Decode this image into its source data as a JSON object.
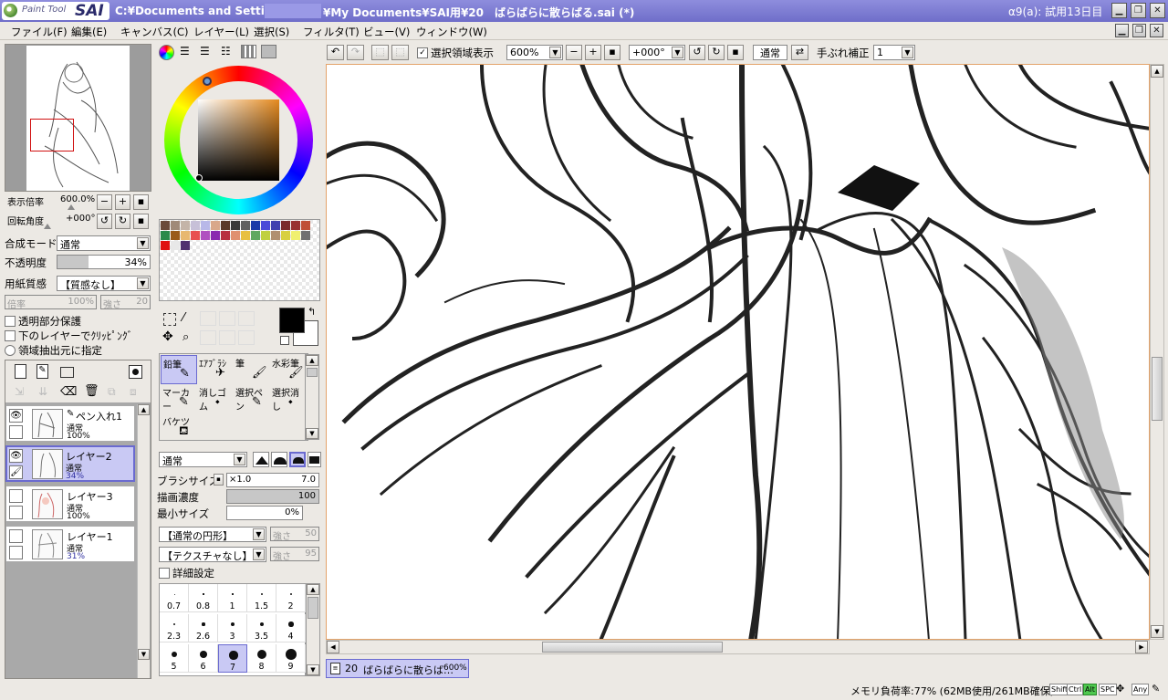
{
  "title": {
    "logo_small": "Paint Tool",
    "logo_big": "SAI",
    "path_start": "C:¥Documents and Settings",
    "path_end": "¥My Documents¥SAI用¥20　ばらばらに散らばる.sai (*)",
    "version": "α9(a): 試用13日目"
  },
  "menu": [
    "ファイル(F)",
    "編集(E)",
    "キャンバス(C)",
    "レイヤー(L)",
    "選択(S)",
    "フィルタ(T)",
    "ビュー(V)",
    "ウィンドウ(W)"
  ],
  "navigator": {
    "zoom_label": "表示倍率",
    "zoom_value": "600.0%",
    "rotate_label": "回転角度",
    "rotate_value": "+000°"
  },
  "layer_props": {
    "blend_label": "合成モード",
    "blend_value": "通常",
    "opacity_label": "不透明度",
    "opacity_value": "34%",
    "opacity_fraction": 0.34,
    "paper_label": "用紙質感",
    "paper_value": "【質感なし】",
    "scale_label": "倍率",
    "scale_value": "100%",
    "strength_label": "強さ",
    "strength_value": "20",
    "protect": "透明部分保護",
    "clip": "下のレイヤーでｸﾘｯﾋﾟﾝｸﾞ",
    "selsrc": "領域抽出元に指定"
  },
  "layers": [
    {
      "name": "ペン入れ1",
      "mode": "通常",
      "opacity": "100%",
      "visible": true,
      "selected": false
    },
    {
      "name": "レイヤー2",
      "mode": "通常",
      "opacity": "34%",
      "visible": true,
      "selected": true
    },
    {
      "name": "レイヤー3",
      "mode": "通常",
      "opacity": "100%",
      "visible": false,
      "selected": false
    },
    {
      "name": "レイヤー1",
      "mode": "通常",
      "opacity": "31%",
      "visible": false,
      "selected": false
    }
  ],
  "swatch_colors": [
    "#6b4a3a",
    "#a08a78",
    "#c4b4a8",
    "#c7c0d8",
    "#b8b8e8",
    "#d9a88a",
    "#5a3a2a",
    "#3b3b3b",
    "#606060",
    "#1a3aa8",
    "#4a4ad8",
    "#4040b0",
    "#7a2a2a",
    "#983030",
    "#c05038",
    "#2a8a4a",
    "#9a5a1a",
    "#e8b870",
    "#e85050",
    "#b050c0",
    "#8a2ab0",
    "#b83040",
    "#e09070",
    "#e8c040",
    "#60a860",
    "#c0d040",
    "#b09070",
    "#d8d040",
    "#f0f070",
    "#707070",
    "#e01010",
    "#e8e8e8",
    "#503070"
  ],
  "brush_tools": [
    {
      "name": "鉛筆",
      "selected": true
    },
    {
      "name": "ｴｱﾌﾞﾗｼ",
      "selected": false
    },
    {
      "name": "筆",
      "selected": false
    },
    {
      "name": "水彩筆",
      "selected": false
    },
    {
      "name": "マーカー",
      "selected": false
    },
    {
      "name": "消しゴム",
      "selected": false
    },
    {
      "name": "選択ペン",
      "selected": false
    },
    {
      "name": "選択消し",
      "selected": false
    },
    {
      "name": "バケツ",
      "selected": false
    }
  ],
  "brush": {
    "blend_value": "通常",
    "size_label": "ブラシサイズ",
    "size_mult": "×1.0",
    "size_value": "7.0",
    "density_label": "描画濃度",
    "density_value": "100",
    "density_fraction": 1.0,
    "min_label": "最小サイズ",
    "min_value": "0%",
    "shape_value": "【通常の円形】",
    "shape_strength_label": "強さ",
    "shape_strength_value": "50",
    "texture_value": "【テクスチャなし】",
    "texture_strength_label": "強さ",
    "texture_strength_value": "95",
    "detail_label": "詳細設定"
  },
  "brush_sizes": [
    "0.7",
    "0.8",
    "1",
    "1.5",
    "2",
    "2.3",
    "2.6",
    "3",
    "3.5",
    "4",
    "5",
    "6",
    "7",
    "8",
    "9"
  ],
  "canvas_toolbar": {
    "show_selection": "選択領域表示",
    "zoom_value": "600%",
    "angle_value": "+000°",
    "mode_value": "通常",
    "stabilizer_label": "手ぶれ補正",
    "stabilizer_value": "1"
  },
  "document_tab": {
    "number": "20",
    "name": "ばらばらに散らば…",
    "zoom": "600%"
  },
  "status": {
    "memory": "メモリ負荷率:77% (62MB使用/261MB確保)",
    "keys": [
      "Shift",
      "Ctrl",
      "Alt",
      "SPC",
      "Any"
    ]
  },
  "colors": {
    "title_bg": "#7877cf",
    "layer_selected": "#c9c9f4",
    "fg_color": "#000000",
    "bg_color": "#ffffff",
    "accent_orange": "#e3a36a"
  }
}
